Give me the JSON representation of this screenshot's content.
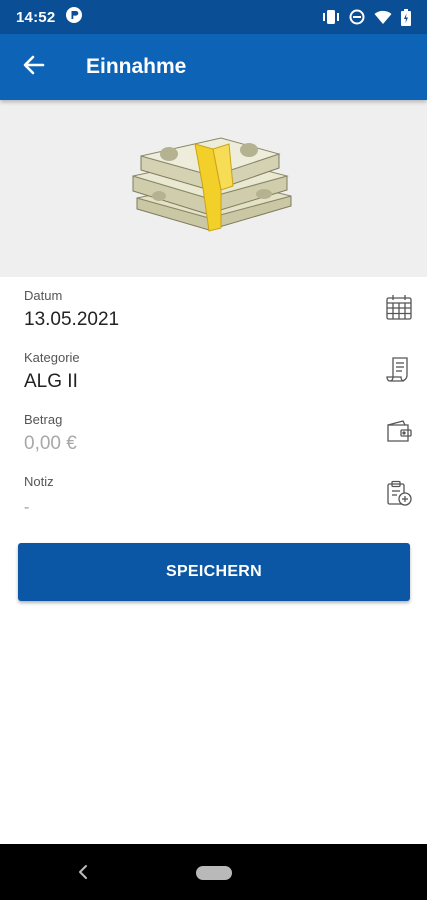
{
  "status_bar": {
    "time": "14:52",
    "icons": [
      "app-notification-icon",
      "vibrate-icon",
      "do-not-disturb-icon",
      "wifi-icon",
      "battery-icon"
    ]
  },
  "app_bar": {
    "title": "Einnahme",
    "back_icon": "arrow-left-icon",
    "color": "#0d64b7"
  },
  "hero": {
    "image": "money-stack-icon"
  },
  "form": {
    "date": {
      "label": "Datum",
      "value": "13.05.2021",
      "icon": "calendar-icon"
    },
    "category": {
      "label": "Kategorie",
      "value": "ALG II",
      "icon": "receipt-icon"
    },
    "amount": {
      "label": "Betrag",
      "placeholder": "0,00 €",
      "icon": "wallet-icon"
    },
    "note": {
      "label": "Notiz",
      "value": "-",
      "icon": "clipboard-add-icon"
    }
  },
  "actions": {
    "save_label": "SPEICHERN",
    "save_color": "#0b57a6"
  },
  "nav_bar": {
    "icons": [
      "nav-back-icon",
      "home-pill-icon"
    ]
  }
}
